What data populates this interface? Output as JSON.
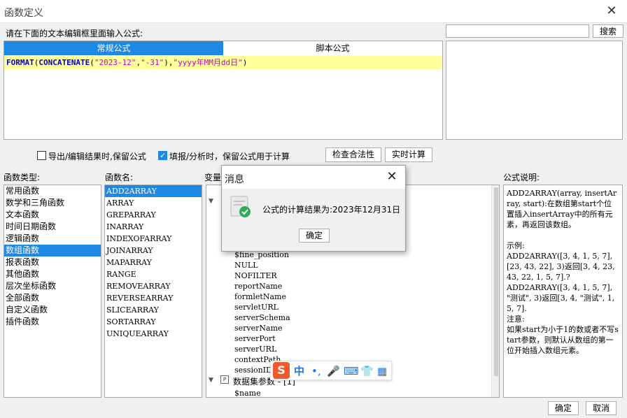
{
  "window": {
    "title": "函数定义",
    "close_label": "✕"
  },
  "editor": {
    "prompt": "请在下面的文本编辑框里面输入公式:",
    "tabs": [
      "常规公式",
      "脚本公式"
    ],
    "formula": {
      "fn1": "FORMAT",
      "p1": "(",
      "fn2": "CONCATENATE",
      "p2": "(",
      "s1": "\"2023-12\"",
      "p3": ",",
      "s2": "\"-31\"",
      "p4": "),",
      "s3": "\"yyyy年MM月dd日\"",
      "p5": ")"
    }
  },
  "search": {
    "value": "",
    "button": "搜索"
  },
  "options": {
    "export_keep": {
      "label": "导出/编辑结果时,保留公式",
      "checked": false
    },
    "fill_keep": {
      "label": "填报/分析时，保留公式用于计算",
      "checked": true
    },
    "check_button": "检查合法性",
    "realtime_button": "实时计算"
  },
  "function_types": {
    "header": "函数类型:",
    "items": [
      "常用函数",
      "数学和三角函数",
      "文本函数",
      "时间日期函数",
      "逻辑函数",
      "数组函数",
      "报表函数",
      "其他函数",
      "层次坐标函数",
      "全部函数",
      "自定义函数",
      "插件函数"
    ],
    "selected_index": 5
  },
  "function_names": {
    "header": "函数名:",
    "items": [
      "ADD2ARRAY",
      "ARRAY",
      "GREPARRAY",
      "INARRAY",
      "INDEXOFARRAY",
      "JOINARRAY",
      "MAPARRAY",
      "RANGE",
      "REMOVEARRAY",
      "REVERSEARRAY",
      "SLICEARRAY",
      "SORTARRAY",
      "UNIQUEARRAY"
    ],
    "selected_index": 0
  },
  "variables": {
    "header": "变量",
    "items": [
      "$fine_position",
      "NULL",
      "NOFILTER",
      "reportName",
      "formletName",
      "servletURL",
      "serverSchema",
      "serverName",
      "serverPort",
      "serverURL",
      "contextPath",
      "sessionID"
    ],
    "dataset_group": "数据集参数 - [1]",
    "dataset_items": [
      "$name_"
    ]
  },
  "description": {
    "header": "公式说明:",
    "lines": [
      "ADD2ARRAY(array, insertArray, start):在数组第start个位置插入insertArray中的所有元素，再返回该数组。",
      "示例:",
      "ADD2ARRAY([3, 4, 1, 5, 7], [23, 43, 22], 3)返回[3, 4, 23, 43, 22, 1, 5, 7].?",
      "ADD2ARRAY([3, 4, 1, 5, 7], \"测试\", 3)返回[3, 4, \"测试\", 1, 5, 7].",
      "注意:",
      "如果start为小于1的数或者不写start参数，则默认从数组的第一位开始插入数组元素。"
    ]
  },
  "footer": {
    "ok": "确定",
    "cancel": "取消"
  },
  "message_dialog": {
    "title": "消息",
    "close": "✕",
    "text": "公式的计算结果为:2023年12月31日",
    "ok": "确定"
  },
  "ime_toolbar": {
    "logo": "S",
    "mode": "中",
    "punct": "•,",
    "mic": "🎤",
    "keyboard": "⌨",
    "skin": "👕",
    "apps": "▦"
  }
}
